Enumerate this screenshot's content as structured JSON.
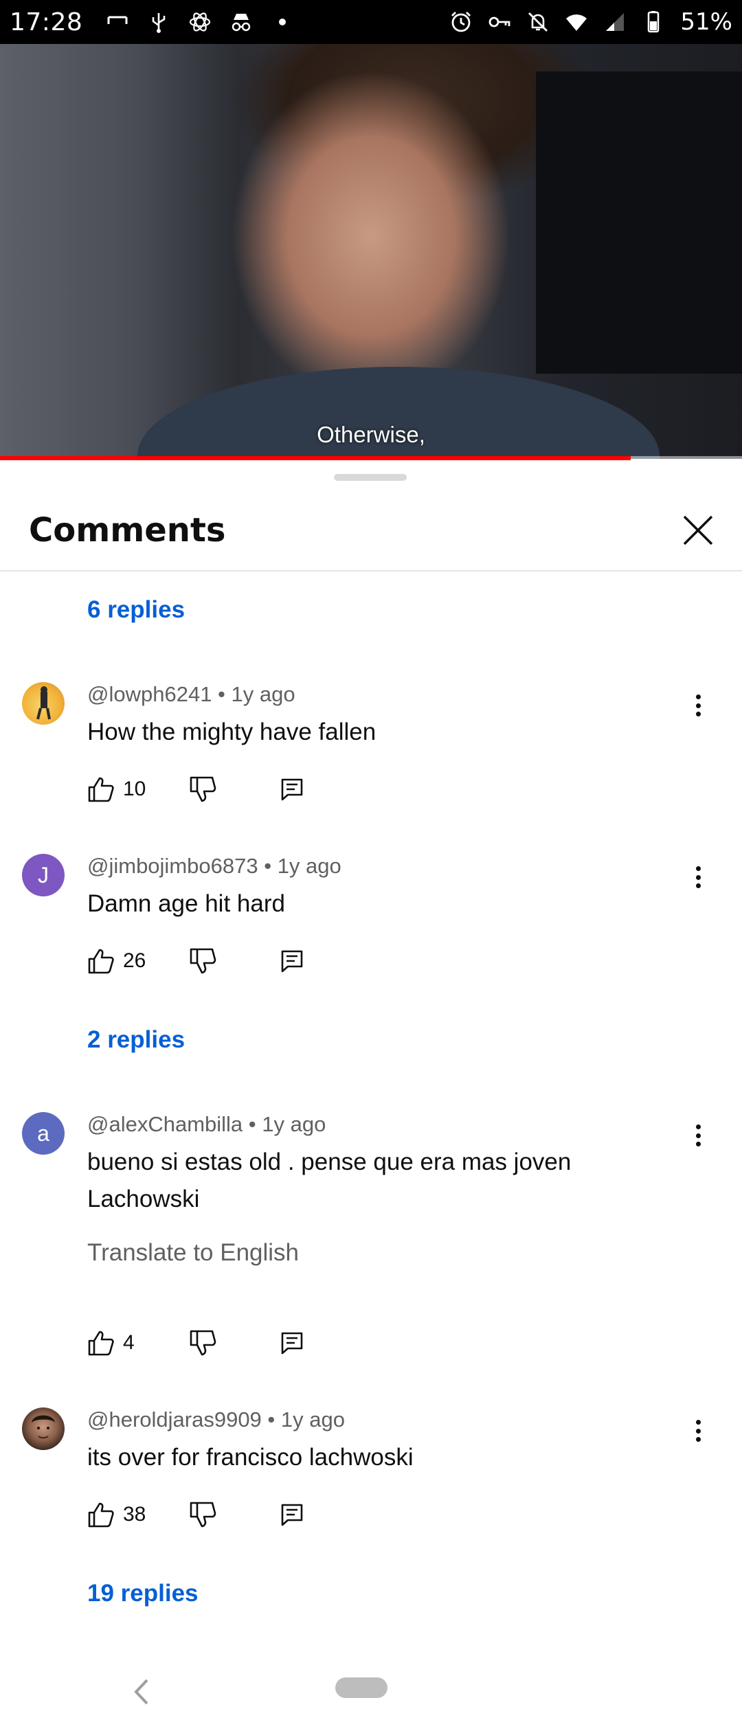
{
  "status_bar": {
    "time": "17:28",
    "battery": "51%",
    "icons": [
      "screen-icon",
      "usb-icon",
      "atom-icon",
      "incognito-icon",
      "dot-icon",
      "alarm-icon",
      "vpn-key-icon",
      "bell-off-icon",
      "wifi-icon",
      "signal-icon",
      "battery-icon"
    ]
  },
  "video": {
    "caption": "Otherwise,",
    "progress": 0.85
  },
  "sheet": {
    "title": "Comments"
  },
  "replies_top": "6 replies",
  "comments": [
    {
      "handle": "@lowph6241",
      "age": "1y ago",
      "text": "How the mighty have fallen",
      "likes": "10",
      "avatar_letter": "",
      "avatar_color": "#f2b33a"
    },
    {
      "handle": "@jimbojimbo6873",
      "age": "1y ago",
      "text": "Damn age hit hard",
      "likes": "26",
      "avatar_letter": "J",
      "avatar_color": "#7e57c2",
      "replies": "2 replies"
    },
    {
      "handle": "@alexChambilla",
      "age": "1y ago",
      "text": "bueno si estas old . pense que era mas joven Lachowski",
      "translate": "Translate to English",
      "likes": "4",
      "avatar_letter": "a",
      "avatar_color": "#5c6bc0"
    },
    {
      "handle": "@heroldjaras9909",
      "age": "1y ago",
      "text": "its over for francisco lachwoski",
      "likes": "38",
      "avatar_letter": "",
      "avatar_color": "#6b4a3a",
      "replies": "19 replies"
    }
  ],
  "colors": {
    "link_blue": "#065fd4",
    "progress_red": "#ff0000",
    "secondary_text": "#606060"
  }
}
